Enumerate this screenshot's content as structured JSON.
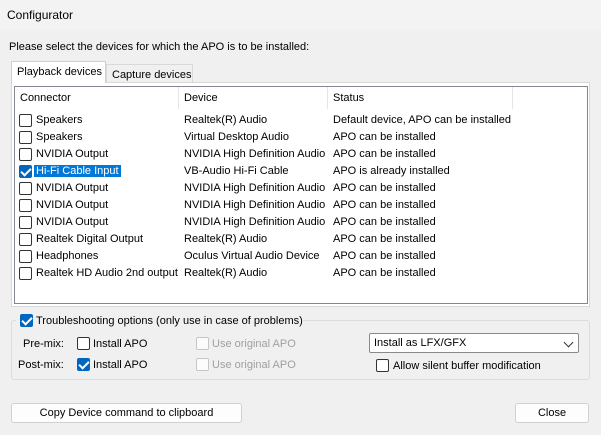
{
  "window": {
    "title": "Configurator"
  },
  "instruction": "Please select the devices for which the APO is to be installed:",
  "tabs": [
    {
      "label": "Playback devices",
      "active": true
    },
    {
      "label": "Capture devices",
      "active": false
    }
  ],
  "table": {
    "columns": [
      "Connector",
      "Device",
      "Status"
    ],
    "rows": [
      {
        "connector": "Speakers",
        "device": "Realtek(R) Audio",
        "status": "Default device, APO can be installed",
        "checked": false
      },
      {
        "connector": "Speakers",
        "device": "Virtual Desktop Audio",
        "status": "APO can be installed",
        "checked": false
      },
      {
        "connector": "NVIDIA Output",
        "device": "NVIDIA High Definition Audio",
        "status": "APO can be installed",
        "checked": false
      },
      {
        "connector": "Hi-Fi Cable Input",
        "device": "VB-Audio Hi-Fi Cable",
        "status": "APO is already installed",
        "checked": true,
        "selected": true
      },
      {
        "connector": "NVIDIA Output",
        "device": "NVIDIA High Definition Audio",
        "status": "APO can be installed",
        "checked": false
      },
      {
        "connector": "NVIDIA Output",
        "device": "NVIDIA High Definition Audio",
        "status": "APO can be installed",
        "checked": false
      },
      {
        "connector": "NVIDIA Output",
        "device": "NVIDIA High Definition Audio",
        "status": "APO can be installed",
        "checked": false
      },
      {
        "connector": "Realtek Digital Output",
        "device": "Realtek(R) Audio",
        "status": "APO can be installed",
        "checked": false
      },
      {
        "connector": "Headphones",
        "device": "Oculus Virtual Audio Device",
        "status": "APO can be installed",
        "checked": false
      },
      {
        "connector": "Realtek HD Audio 2nd output",
        "device": "Realtek(R) Audio",
        "status": "APO can be installed",
        "checked": false
      }
    ]
  },
  "troubleshooting": {
    "label": "Troubleshooting options (only use in case of problems)",
    "checked": true,
    "premix": {
      "label": "Pre-mix:",
      "install_label": "Install APO",
      "install_checked": false,
      "original_label": "Use original APO",
      "original_checked": false
    },
    "postmix": {
      "label": "Post-mix:",
      "install_label": "Install APO",
      "install_checked": true,
      "original_label": "Use original APO",
      "original_checked": false
    },
    "install_mode": "Install as LFX/GFX",
    "silent_buffer_label": "Allow silent buffer modification",
    "silent_buffer_checked": false
  },
  "buttons": {
    "copy": "Copy Device command to clipboard",
    "close": "Close"
  },
  "colors": {
    "accent": "#0067c0",
    "selection": "#0078d7",
    "background": "#f0f0f0"
  }
}
